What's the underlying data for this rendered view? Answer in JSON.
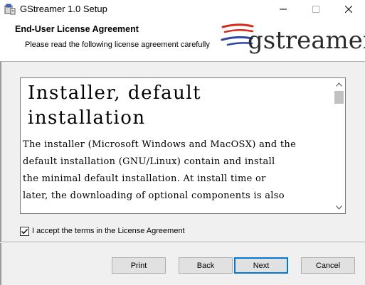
{
  "window": {
    "title": "GStreamer 1.0 Setup"
  },
  "header": {
    "title": "End-User License Agreement",
    "subtitle": "Please read the following license agreement carefully",
    "logo_text": "gstreamer"
  },
  "license": {
    "heading_line1": "Installer, default",
    "heading_line2": "installation",
    "paragraph_lines": [
      "The installer (Microsoft Windows and MacOSX) and the",
      "default installation (GNU/Linux) contain and install",
      "the minimal default installation. At install time or",
      "later, the downloading of optional components is also"
    ]
  },
  "accept": {
    "label": "I accept the terms in the License Agreement",
    "checked": true
  },
  "buttons": {
    "print": "Print",
    "back": "Back",
    "next": "Next",
    "cancel": "Cancel"
  },
  "colors": {
    "accent": "#0078d7",
    "logo_red": "#d42a20",
    "logo_blue": "#2e45a6",
    "logo_text": "#2b2b2b"
  }
}
